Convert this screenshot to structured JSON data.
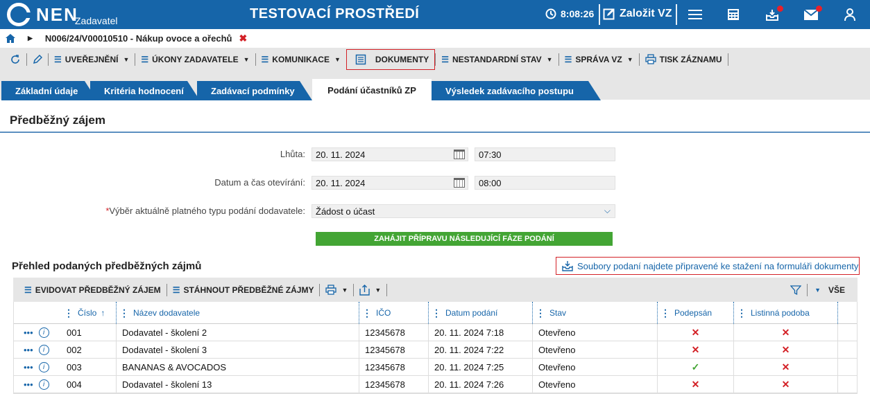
{
  "topbar": {
    "logo_text": "NEN",
    "logo_sub": "Zadavatel",
    "env_title": "TESTOVACÍ PROSTŘEDÍ",
    "clock": "8:08:26",
    "zalozit_label": "Založit VZ",
    "icons": [
      "clock-icon",
      "edit-icon",
      "menu-icon",
      "calculator-icon",
      "inbox-icon",
      "mail-icon",
      "user-icon"
    ]
  },
  "breadcrumb": {
    "path": "N006/24/V00010510 - Nákup ovoce a ořechů"
  },
  "toolbar": {
    "uverejneni": "UVEŘEJNĚNÍ",
    "ukony": "ÚKONY ZADAVATELE",
    "komunikace": "KOMUNIKACE",
    "dokumenty": "DOKUMENTY",
    "nestandardni": "NESTANDARDNÍ STAV",
    "sprava": "SPRÁVA VZ",
    "tisk": "TISK ZÁZNAMU"
  },
  "tabs": [
    "Základní údaje",
    "Kritéria hodnocení",
    "Zadávací podmínky",
    "Podání účastníků ZP",
    "Výsledek zadávacího postupu"
  ],
  "section_title": "Předběžný zájem",
  "form": {
    "lhuta_label": "Lhůta:",
    "lhuta_date": "20. 11. 2024",
    "lhuta_time": "07:30",
    "otevirani_label": "Datum a čas otevírání:",
    "otevirani_date": "20. 11. 2024",
    "otevirani_time": "08:00",
    "typ_required": "*",
    "typ_label": "Výběr aktuálně platného typu podání dodavatele:",
    "typ_value": "Žádost o účast",
    "zahajit_button": "ZAHÁJIT PŘÍPRAVU NÁSLEDUJÍCÍ FÁZE PODÁNÍ"
  },
  "list": {
    "title": "Přehled podaných předběžných zájmů",
    "soubory_link": "Soubory podaní najdete připravené ke stažení na formuláři dokumenty",
    "evidovat": "EVIDOVAT PŘEDBĚŽNÝ ZÁJEM",
    "stahnout": "STÁHNOUT PŘEDBĚŽNÉ ZÁJMY",
    "vse": "VŠE",
    "columns": {
      "cislo": "Číslo",
      "nazev": "Název dodavatele",
      "ico": "IČO",
      "datum": "Datum podání",
      "stav": "Stav",
      "podepsan": "Podepsán",
      "listinna": "Listinná podoba"
    },
    "rows": [
      {
        "cislo": "001",
        "nazev": "Dodavatel - školení 2",
        "ico": "12345678",
        "datum": "20. 11. 2024 7:18",
        "stav": "Otevřeno",
        "podepsan": "✕",
        "listinna": "✕"
      },
      {
        "cislo": "002",
        "nazev": "Dodavatel - školení 3",
        "ico": "12345678",
        "datum": "20. 11. 2024 7:22",
        "stav": "Otevřeno",
        "podepsan": "✕",
        "listinna": "✕"
      },
      {
        "cislo": "003",
        "nazev": "BANANAS & AVOCADOS",
        "ico": "12345678",
        "datum": "20. 11. 2024 7:25",
        "stav": "Otevřeno",
        "podepsan": "✓",
        "listinna": "✕"
      },
      {
        "cislo": "004",
        "nazev": "Dodavatel - školení 13",
        "ico": "12345678",
        "datum": "20. 11. 2024 7:26",
        "stav": "Otevřeno",
        "podepsan": "✕",
        "listinna": "✕"
      }
    ]
  },
  "colors": {
    "brand": "#1665a9",
    "accent_red": "#d32026",
    "green": "#43a534"
  }
}
